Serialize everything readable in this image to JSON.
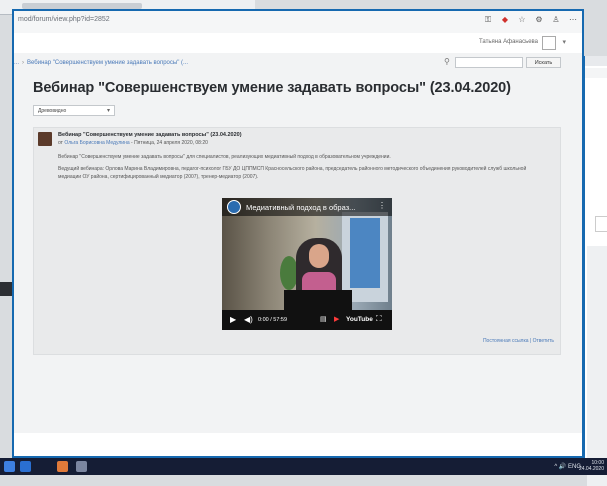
{
  "browser": {
    "url": "mod/forum/view.php?id=2852",
    "toolbar_icons": [
      "key-icon",
      "extension-icon",
      "bookmark-star-icon",
      "settings-icon",
      "profile-icon",
      "menu-icon"
    ]
  },
  "user_bar": {
    "user_name": "Татьяна Афанасьева"
  },
  "breadcrumb": {
    "items": [
      "...",
      "Вебинар \"Совершенствуем умение задавать вопросы\" (..."
    ]
  },
  "search": {
    "placeholder": "",
    "button_label": "Искать"
  },
  "page": {
    "title": "Вебинар \"Совершенствуем умение задавать вопросы\" (23.04.2020)",
    "display_mode": "Древовидно"
  },
  "post": {
    "subject": "Вебинар \"Совершенствуем умение задавать вопросы\" (23.04.2020)",
    "author_prefix": "от",
    "author_name": "Ольга Борисовна Медулина",
    "date": "- Пятница, 24 апреля 2020, 08:20",
    "text_1": "Вебинар \"Совершенствуем умение задавать вопросы\" для специалистов, реализующих медиативный подход в образовательном учреждении.",
    "text_2": "Ведущий вебинара: Орлова Марина Владимировна, педагог-психолог ГБУ ДО ЦППМСП Красносельского района, председатель районного методического объединения руководителей служб школьной медиации ОУ района, сертифицированный медиатор (2007), тренер-медиатор (2007).",
    "footer_links": "Постоянная ссылка | Ответить"
  },
  "video": {
    "title": "Медиативный подход в образ...",
    "time": "0:00 / 57:59",
    "logo_text": "YouTube"
  },
  "taskbar": {
    "tray": "^ 🔊 ENG",
    "clock_time": "10:00",
    "clock_date": "24.04.2020"
  },
  "colors": {
    "window_border": "#1669b0",
    "link": "#4a79b8",
    "taskbar": "#151d35"
  }
}
